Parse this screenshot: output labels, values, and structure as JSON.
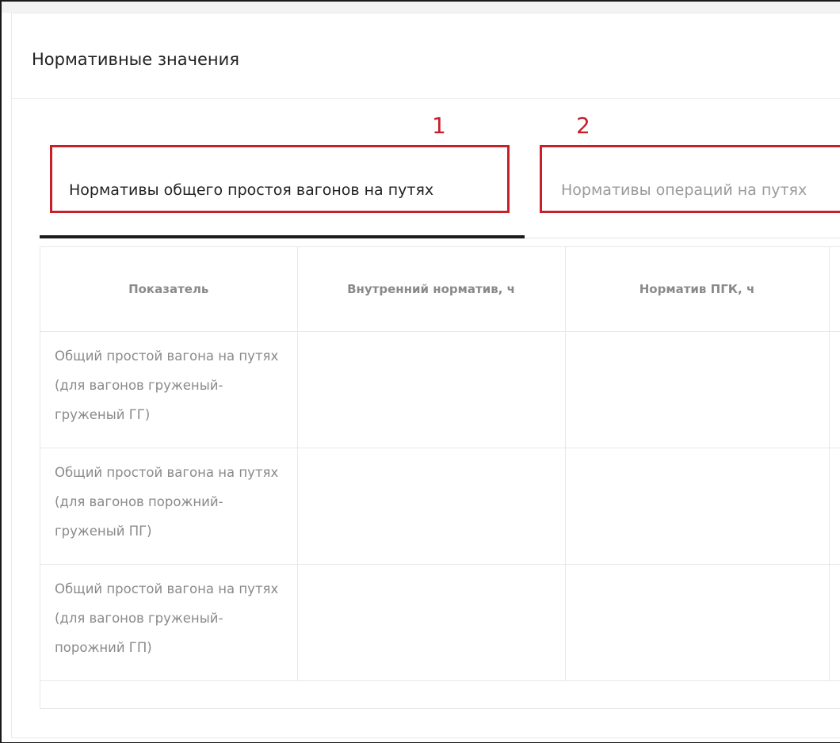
{
  "page": {
    "title": "Нормативные значения"
  },
  "tabs": [
    {
      "label": "Нормативы общего простоя вагонов на путях",
      "active": true
    },
    {
      "label": "Нормативы операций на путях",
      "active": false
    }
  ],
  "annotations": [
    {
      "number": "1",
      "color": "#c81f2a"
    },
    {
      "number": "2",
      "color": "#c81f2a"
    }
  ],
  "table": {
    "headers": [
      "Показатель",
      "Внутренний норматив, ч",
      "Норматив ПГК, ч",
      ""
    ],
    "rows": [
      {
        "indicator": "Общий простой вагона на путях (для вагонов груженый-груженый ГГ)",
        "internal": "",
        "pgk": "",
        "extra": ""
      },
      {
        "indicator": "Общий простой вагона на путях (для вагонов порожний-груженый ПГ)",
        "internal": "",
        "pgk": "",
        "extra": ""
      },
      {
        "indicator": "Общий простой вагона на путях (для вагонов груженый-порожний ГП)",
        "internal": "",
        "pgk": "",
        "extra": ""
      }
    ]
  },
  "colors": {
    "annotation": "#c81f2a",
    "active_tab_text": "#222222",
    "inactive_tab_text": "#9a9a9a",
    "table_text": "#8a8a8a",
    "active_tab_bar": "#1b1b1b"
  }
}
